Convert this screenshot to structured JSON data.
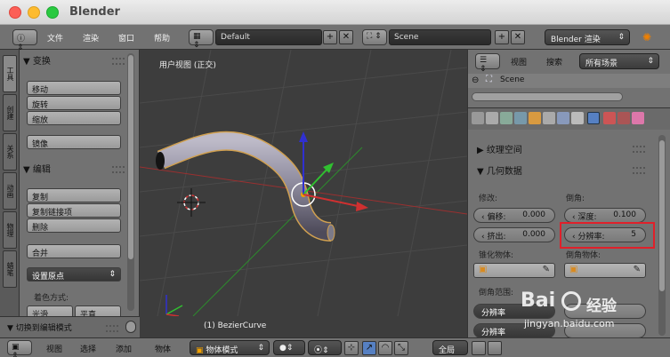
{
  "window": {
    "title": "Blender"
  },
  "info_header": {
    "menus": [
      "文件",
      "渲染",
      "窗口",
      "帮助"
    ],
    "layout": "Default",
    "scene": "Scene",
    "engine": "Blender 渲染"
  },
  "tool_shelf": {
    "tabs": [
      "工具",
      "创建",
      "关系",
      "动画",
      "物理",
      "蜡笔"
    ],
    "transform": {
      "title": "变换",
      "buttons": [
        "移动",
        "旋转",
        "缩放"
      ],
      "mirror": "镜像"
    },
    "edit": {
      "title": "编辑",
      "buttons": [
        "复制",
        "复制链接项",
        "删除"
      ],
      "join": "合并",
      "set_origin": "设置原点",
      "shading_label": "着色方式:",
      "shading_options": [
        "光滑",
        "平直"
      ]
    },
    "toggle_edit_mode": "切换到编辑模式"
  },
  "viewport": {
    "title": "用户视图 (正交)",
    "object_label": "(1) BezierCurve"
  },
  "bottom_header": {
    "menus": [
      "视图",
      "选择",
      "添加",
      "物体"
    ],
    "mode": "物体模式",
    "global": "全局"
  },
  "outliner": {
    "view": "视图",
    "search": "搜索",
    "filter": "所有场景",
    "scene": "Scene"
  },
  "properties": {
    "texture_space": "纹理空间",
    "geometry": {
      "title": "几何数据",
      "modification_label": "修改:",
      "bevel_label": "倒角:",
      "offset": {
        "label": "偏移:",
        "value": "0.000"
      },
      "extrude": {
        "label": "挤出:",
        "value": "0.000"
      },
      "depth": {
        "label": "深度:",
        "value": "0.100"
      },
      "resolution": {
        "label": "分辨率:",
        "value": "5"
      },
      "taper_label": "锥化物体:",
      "bevel_object_label": "倒角物体:",
      "bevel_range_label": "倒角范围:",
      "range_buttons": [
        "分辨率",
        "分辨率"
      ]
    },
    "highlight_color": "#e0202a"
  },
  "watermark": {
    "brand": "Bai",
    "brand2": "经验",
    "url": "jingyan.baidu.com"
  }
}
